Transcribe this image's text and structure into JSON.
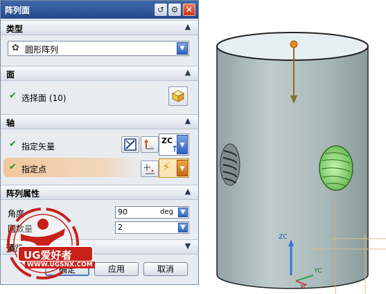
{
  "dialog": {
    "title": "阵列面",
    "buttons": {
      "reset": "↺",
      "settings": "⚙",
      "close": "✕"
    }
  },
  "sections": {
    "type": {
      "label": "类型",
      "value": "圆形阵列"
    },
    "face": {
      "label": "面",
      "select_face": "选择面 (10)"
    },
    "axis": {
      "label": "轴",
      "specify_vector": "指定矢量",
      "vector_value": "ZC",
      "specify_point": "指定点"
    },
    "pattern": {
      "label": "阵列属性",
      "angle_label": "角度",
      "angle_value": "90",
      "angle_unit": "deg",
      "count_label": "圆数量",
      "count_value": "2"
    },
    "preview": {
      "label": "预览"
    }
  },
  "footer": {
    "ok": "确定",
    "apply": "应用",
    "cancel": "取消"
  },
  "viewport": {
    "axis_z": "ZC",
    "axis_y": "YC",
    "axis_x": "XC"
  },
  "watermark": {
    "brand": "UG爱好者",
    "url": "WWW.UGSNX.COM"
  },
  "colors": {
    "title_bar": "#2f579a",
    "cylinder": "#a9b8b8",
    "hole_highlight": "#8fe07a",
    "check": "#1d9a1d",
    "watermark": "#c8201a"
  }
}
